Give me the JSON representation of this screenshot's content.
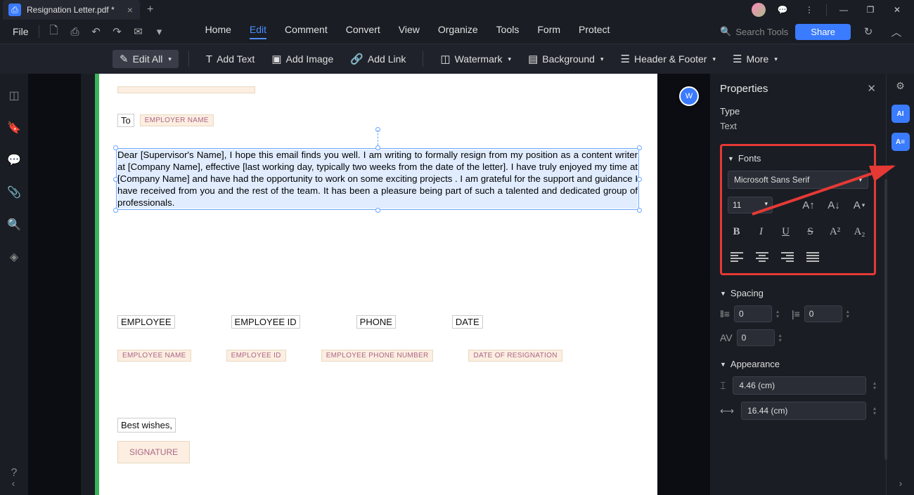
{
  "titlebar": {
    "tab_title": "Resignation Letter.pdf *"
  },
  "menubar": {
    "file": "File",
    "items": [
      "Home",
      "Edit",
      "Comment",
      "Convert",
      "View",
      "Organize",
      "Tools",
      "Form",
      "Protect"
    ],
    "active_index": 1,
    "search_placeholder": "Search Tools",
    "share": "Share"
  },
  "toolbar": {
    "edit_all": "Edit All",
    "add_text": "Add Text",
    "add_image": "Add Image",
    "add_link": "Add Link",
    "watermark": "Watermark",
    "background": "Background",
    "header_footer": "Header & Footer",
    "more": "More"
  },
  "document": {
    "to_label": "To",
    "employer_ph": "EMPLOYER NAME",
    "body": "Dear [Supervisor's Name], I hope this email finds you well. I am writing to formally resign from my position as a content writer at [Company Name], effective [last working day, typically two weeks from the date of the letter]. I have truly enjoyed my time at [Company Name] and have had the opportunity to work on some exciting projects . I am grateful for the support and guidance I have received from you and the rest of the team. It has been a pleasure being part of such a talented and dedicated group of professionals.",
    "labels": {
      "employee": "EMPLOYEE",
      "employee_id": "EMPLOYEE ID",
      "phone": "PHONE",
      "date": "DATE"
    },
    "placeholders": {
      "emp_name": "EMPLOYEE NAME",
      "emp_id": "EMPLOYEE ID",
      "phone": "EMPLOYEE PHONE NUMBER",
      "date": "DATE OF RESIGNATION"
    },
    "closing": "Best wishes,",
    "signature": "SIGNATURE"
  },
  "properties": {
    "title": "Properties",
    "type_label": "Type",
    "type_value": "Text",
    "fonts_label": "Fonts",
    "font_name": "Microsoft Sans Serif",
    "font_size": "11",
    "spacing_label": "Spacing",
    "spacing_line": "0",
    "spacing_char": "0",
    "spacing_av": "0",
    "appearance_label": "Appearance",
    "width_val": "4.46 (cm)",
    "height_val": "16.44 (cm)"
  }
}
